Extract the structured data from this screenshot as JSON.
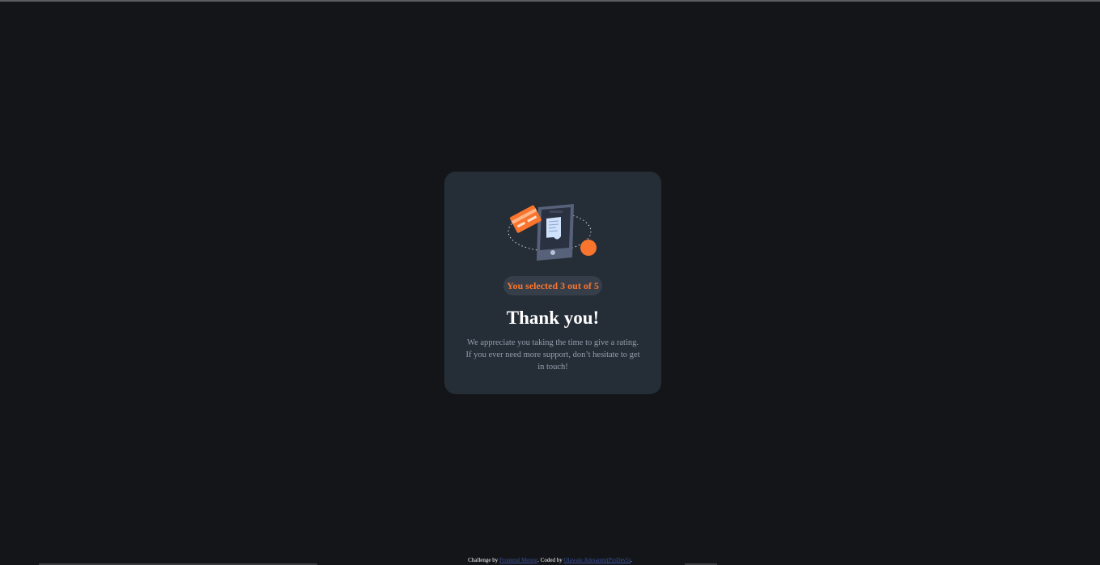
{
  "card": {
    "illustration": "payment-phone-illustration",
    "selected_text": "You selected 3 out of 5",
    "title": "Thank you!",
    "description": "We appreciate you taking the time to give a rating. If you ever need more support, don’t hesitate to get in touch!"
  },
  "footer": {
    "prefix": "Challenge by ",
    "link1": "Frontend Mentor",
    "middle": ". Coded by ",
    "link2": "Olawale Adesanmi(ProDev5)",
    "suffix": "."
  },
  "colors": {
    "background": "#131518",
    "card": "#252d37",
    "accent": "#f9752d",
    "muted": "#959eac"
  }
}
